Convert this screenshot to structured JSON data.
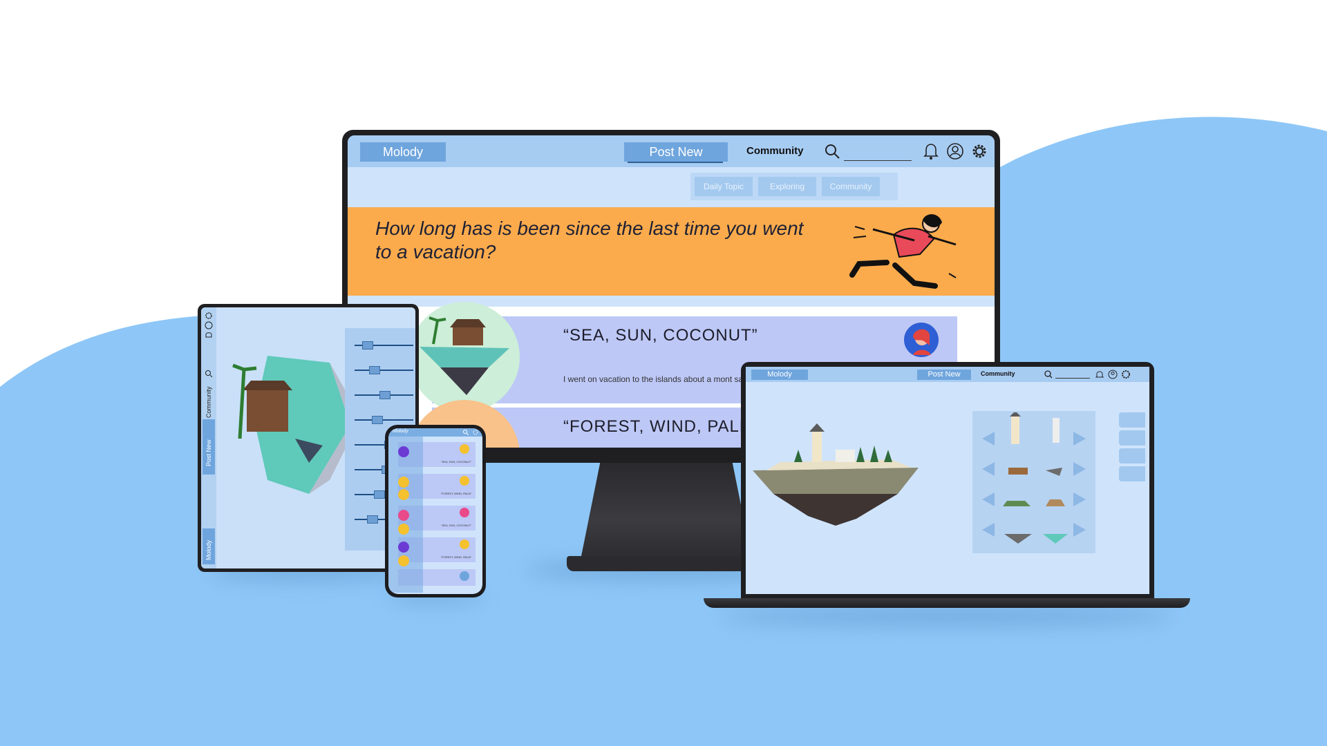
{
  "colors": {
    "background_blue": "#8ec7f7",
    "nav_blue": "#a7ccf2",
    "button_blue": "#6fa5dd",
    "banner_orange": "#fbab4c",
    "card_lavender": "#bdc8f6"
  },
  "desktop": {
    "logo": "Molody",
    "post_new": "Post New",
    "community": "Community",
    "subtabs": [
      "Daily Topic",
      "Exploring",
      "Community"
    ],
    "banner_question": "How long has is been since the last time you went to a vacation?",
    "posts": [
      {
        "title": "“SEA, SUN, COCONUT”",
        "body": "I went on vacation to the islands about a mont sand there was just wonderful."
      },
      {
        "title": "“FOREST, WIND, PALM”"
      }
    ],
    "icons": [
      "search-icon",
      "bell-icon",
      "profile-icon",
      "settings-icon"
    ]
  },
  "tablet": {
    "side_labels": [
      "Community",
      "Post New",
      "Molody"
    ],
    "slider_levels": [
      0.15,
      0.3,
      0.5,
      0.35,
      0.6,
      0.55,
      0.4,
      0.25
    ]
  },
  "phone": {
    "logo": "Molody",
    "captions": [
      "“SEA, SUN, COCONUT”",
      "“FOREST, WIND, PALM”",
      "“SEA, SUN, COCONUT”",
      "“FOREST, WIND, PALM”"
    ]
  },
  "laptop": {
    "logo": "Molody",
    "post_new": "Post New",
    "community": "Community"
  }
}
